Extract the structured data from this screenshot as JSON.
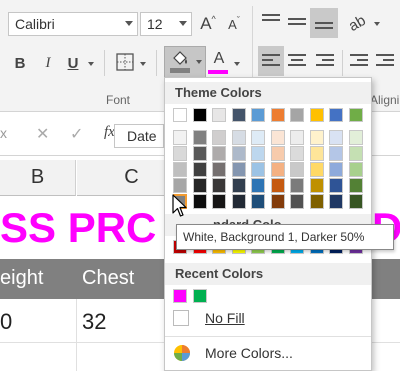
{
  "ribbon": {
    "font_name": "Calibri",
    "font_size": "12",
    "grow_label": "A",
    "shrink_label": "A",
    "bold": "B",
    "italic": "I",
    "underline": "U",
    "font_color_label": "A",
    "font_group_label": "Font",
    "alignment_group_label_partial": "Aligni"
  },
  "formula_bar": {
    "cancel_glyph": "✕",
    "enter_glyph": "✓",
    "fx_label": "fx",
    "content_partial": "Date"
  },
  "sheet": {
    "column_headers": [
      "B",
      "C"
    ],
    "title_partial": "SS PRC",
    "title_tail_partial": "D",
    "header_cells": [
      "eight",
      "Chest"
    ],
    "row_values": [
      "0",
      "32"
    ]
  },
  "color_menu": {
    "theme_colors_label": "Theme Colors",
    "standard_colors_label_partial": "ndard Colo",
    "recent_colors_label": "Recent Colors",
    "no_fill_label": "No Fill",
    "more_colors_label": "More Colors...",
    "theme_top_row": [
      "#ffffff",
      "#000000",
      "#e7e6e6",
      "#44546a",
      "#5b9bd5",
      "#ed7d31",
      "#a5a5a5",
      "#ffc000",
      "#4472c4",
      "#70ad47"
    ],
    "theme_shades": [
      [
        "#f2f2f2",
        "#808080",
        "#d0cece",
        "#d6dce4",
        "#deebf6",
        "#fbe5d5",
        "#ededed",
        "#fff2cc",
        "#d9e2f3",
        "#e2efd9"
      ],
      [
        "#d9d9d9",
        "#595959",
        "#aeabab",
        "#adb9ca",
        "#bdd7ee",
        "#f7cbac",
        "#dbdbdb",
        "#fee599",
        "#b4c6e7",
        "#c5e0b3"
      ],
      [
        "#bfbfbf",
        "#404040",
        "#757070",
        "#8496b0",
        "#9cc3e5",
        "#f4b183",
        "#c9c9c9",
        "#ffd966",
        "#8eaadb",
        "#a8d08d"
      ],
      [
        "#a6a6a6",
        "#262626",
        "#3a3838",
        "#323f4f",
        "#2e75b5",
        "#c55a11",
        "#7b7b7b",
        "#bf9000",
        "#2f5496",
        "#538135"
      ],
      [
        "#808080",
        "#0d0d0d",
        "#171616",
        "#222a35",
        "#1f4e79",
        "#833c0b",
        "#525252",
        "#7f6000",
        "#1f3864",
        "#375623"
      ]
    ],
    "standard_colors": [
      "#c00000",
      "#ff0000",
      "#ffc000",
      "#ffff00",
      "#92d050",
      "#00b050",
      "#00b0f0",
      "#0070c0",
      "#002060",
      "#7030a0"
    ],
    "recent_colors": [
      "#ff00ff",
      "#00b050"
    ],
    "selected_color": "#808080"
  },
  "tooltip": {
    "text": "White, Background 1, Darker 50%"
  }
}
